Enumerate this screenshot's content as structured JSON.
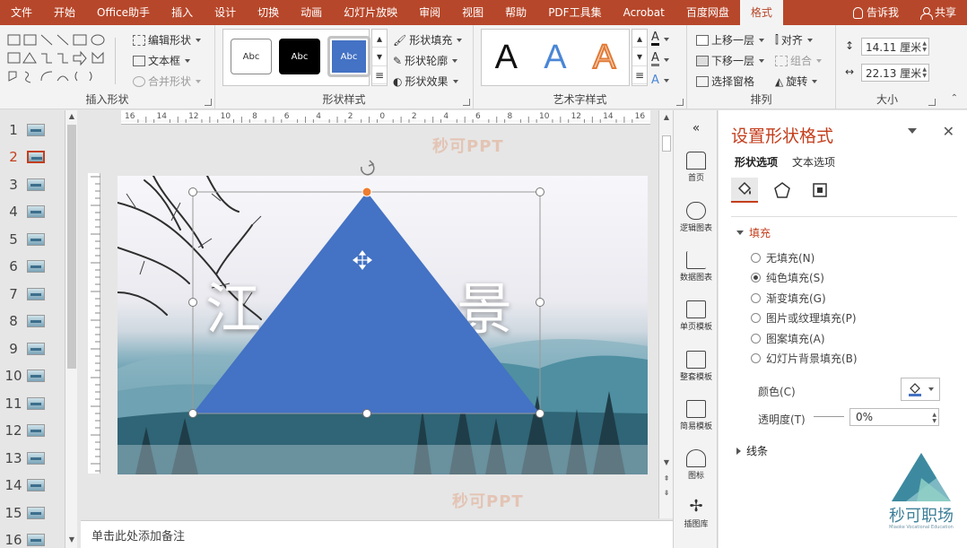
{
  "tabs": {
    "items": [
      "文件",
      "开始",
      "Office助手",
      "插入",
      "设计",
      "切换",
      "动画",
      "幻灯片放映",
      "审阅",
      "视图",
      "帮助",
      "PDF工具集",
      "Acrobat",
      "百度网盘",
      "格式"
    ],
    "active_index": 14,
    "tell_me": "告诉我",
    "share": "共享"
  },
  "ribbon": {
    "insert_shapes": {
      "label": "插入形状",
      "edit_shape": "编辑形状",
      "text_box": "文本框",
      "merge_shapes": "合并形状"
    },
    "shape_styles": {
      "label": "形状样式",
      "samples": [
        "Abc",
        "Abc",
        "Abc"
      ],
      "fill": "形状填充",
      "outline": "形状轮廓",
      "effects": "形状效果"
    },
    "wordart": {
      "label": "艺术字样式",
      "samples": [
        "A",
        "A",
        "A"
      ]
    },
    "arrange": {
      "label": "排列",
      "bring_forward": "上移一层",
      "send_backward": "下移一层",
      "selection_pane": "选择窗格",
      "align": "对齐",
      "group": "组合",
      "rotate": "旋转"
    },
    "size": {
      "label": "大小",
      "height": "14.11 厘米",
      "width": "22.13 厘米"
    }
  },
  "thumbnails": {
    "numbers": [
      "1",
      "2",
      "3",
      "4",
      "5",
      "6",
      "7",
      "8",
      "9",
      "10",
      "11",
      "12",
      "13",
      "14",
      "15",
      "16"
    ],
    "active_index": 1
  },
  "editor": {
    "watermark": "秒可PPT",
    "slide_text_left": "江",
    "slide_text_right": "景",
    "notes_placeholder": "单击此处添加备注",
    "ruler_labels": [
      "16",
      "14",
      "12",
      "10",
      "8",
      "6",
      "4",
      "2",
      "0",
      "2",
      "4",
      "6",
      "8",
      "10",
      "12",
      "14",
      "16"
    ]
  },
  "side_strip": {
    "items": [
      "首页",
      "逻辑图表",
      "数据图表",
      "单页模板",
      "整套模板",
      "简易模板",
      "图标",
      "插图库"
    ]
  },
  "format_pane": {
    "title": "设置形状格式",
    "tab_shape": "形状选项",
    "tab_text": "文本选项",
    "fill_header": "填充",
    "options": [
      "无填充(N)",
      "纯色填充(S)",
      "渐变填充(G)",
      "图片或纹理填充(P)",
      "图案填充(A)",
      "幻灯片背景填充(B)"
    ],
    "selected_option": 1,
    "color_label": "颜色(C)",
    "transparency_label": "透明度(T)",
    "transparency_value": "0%",
    "line_header": "线条"
  },
  "logo": {
    "text": "秒可职场",
    "sub": "Miaoke Vocational Education"
  },
  "colors": {
    "accent": "#b7472a",
    "triangle": "#4472c4",
    "pane_title": "#c43e1c"
  }
}
